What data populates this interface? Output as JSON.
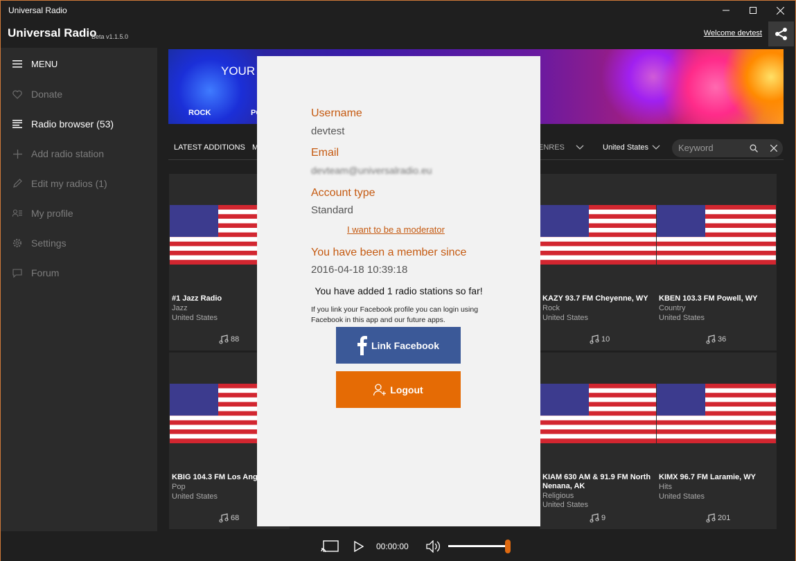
{
  "window": {
    "title": "Universal Radio"
  },
  "appbar": {
    "title": "Universal Radio",
    "version": "Beta v1.1.5.0",
    "welcome": "Welcome devtest"
  },
  "sidebar": {
    "menu_label": "MENU",
    "items": [
      {
        "label": "Donate",
        "icon": "heart-icon"
      },
      {
        "label": "Radio browser (53)",
        "icon": "list-icon"
      },
      {
        "label": "Add radio station",
        "icon": "plus-icon"
      },
      {
        "label": "Edit my radios (1)",
        "icon": "pencil-icon"
      },
      {
        "label": "My profile",
        "icon": "profile-icon"
      },
      {
        "label": "Settings",
        "icon": "gear-icon"
      },
      {
        "label": "Forum",
        "icon": "chat-icon"
      }
    ]
  },
  "banner": {
    "text": "YOUR",
    "categories": [
      "ROCK",
      "PO"
    ]
  },
  "filters": {
    "latest": "LATEST ADDITIONS",
    "partial_tab": "M",
    "genres": "ENRES",
    "country": "United States",
    "search_placeholder": "Keyword"
  },
  "cards": [
    {
      "name": "#1 Jazz Radio",
      "genre": "Jazz",
      "country": "United States",
      "likes": "88"
    },
    {
      "name": "KAZY 93.7 FM Cheyenne, WY",
      "genre": "Rock",
      "country": "United States",
      "likes": "10"
    },
    {
      "name": "KBEN 103.3 FM Powell, WY",
      "genre": "Country",
      "country": "United States",
      "likes": "36"
    },
    {
      "name": "KBIG 104.3 FM Los Ange",
      "genre": "Pop",
      "country": "United States",
      "likes": "68"
    },
    {
      "name": "KIAM 630 AM & 91.9 FM North",
      "name2": "Nenana, AK",
      "genre": "Religious",
      "country": "United States",
      "likes": "9"
    },
    {
      "name": "KIMX 96.7 FM Laramie, WY",
      "genre": "Hits",
      "country": "United States",
      "likes": "201"
    }
  ],
  "profile": {
    "username_label": "Username",
    "username": "devtest",
    "email_label": "Email",
    "email": "devteam@universalradio.eu",
    "account_type_label": "Account type",
    "account_type": "Standard",
    "moderator_link": "I want to be a moderator",
    "member_since_label": "You have been a member since",
    "member_since": "2016-04-18 10:39:18",
    "added_note": "You have added 1 radio stations so far!",
    "facebook_note": "If you link your Facebook profile you can login using Facebook in this app and our future apps.",
    "facebook_button": "Link Facebook",
    "logout_button": "Logout"
  },
  "player": {
    "time": "00:00:00",
    "volume": 0.9
  },
  "colors": {
    "accent": "#c55a11",
    "facebook": "#3b5998",
    "logout": "#e56b05"
  }
}
